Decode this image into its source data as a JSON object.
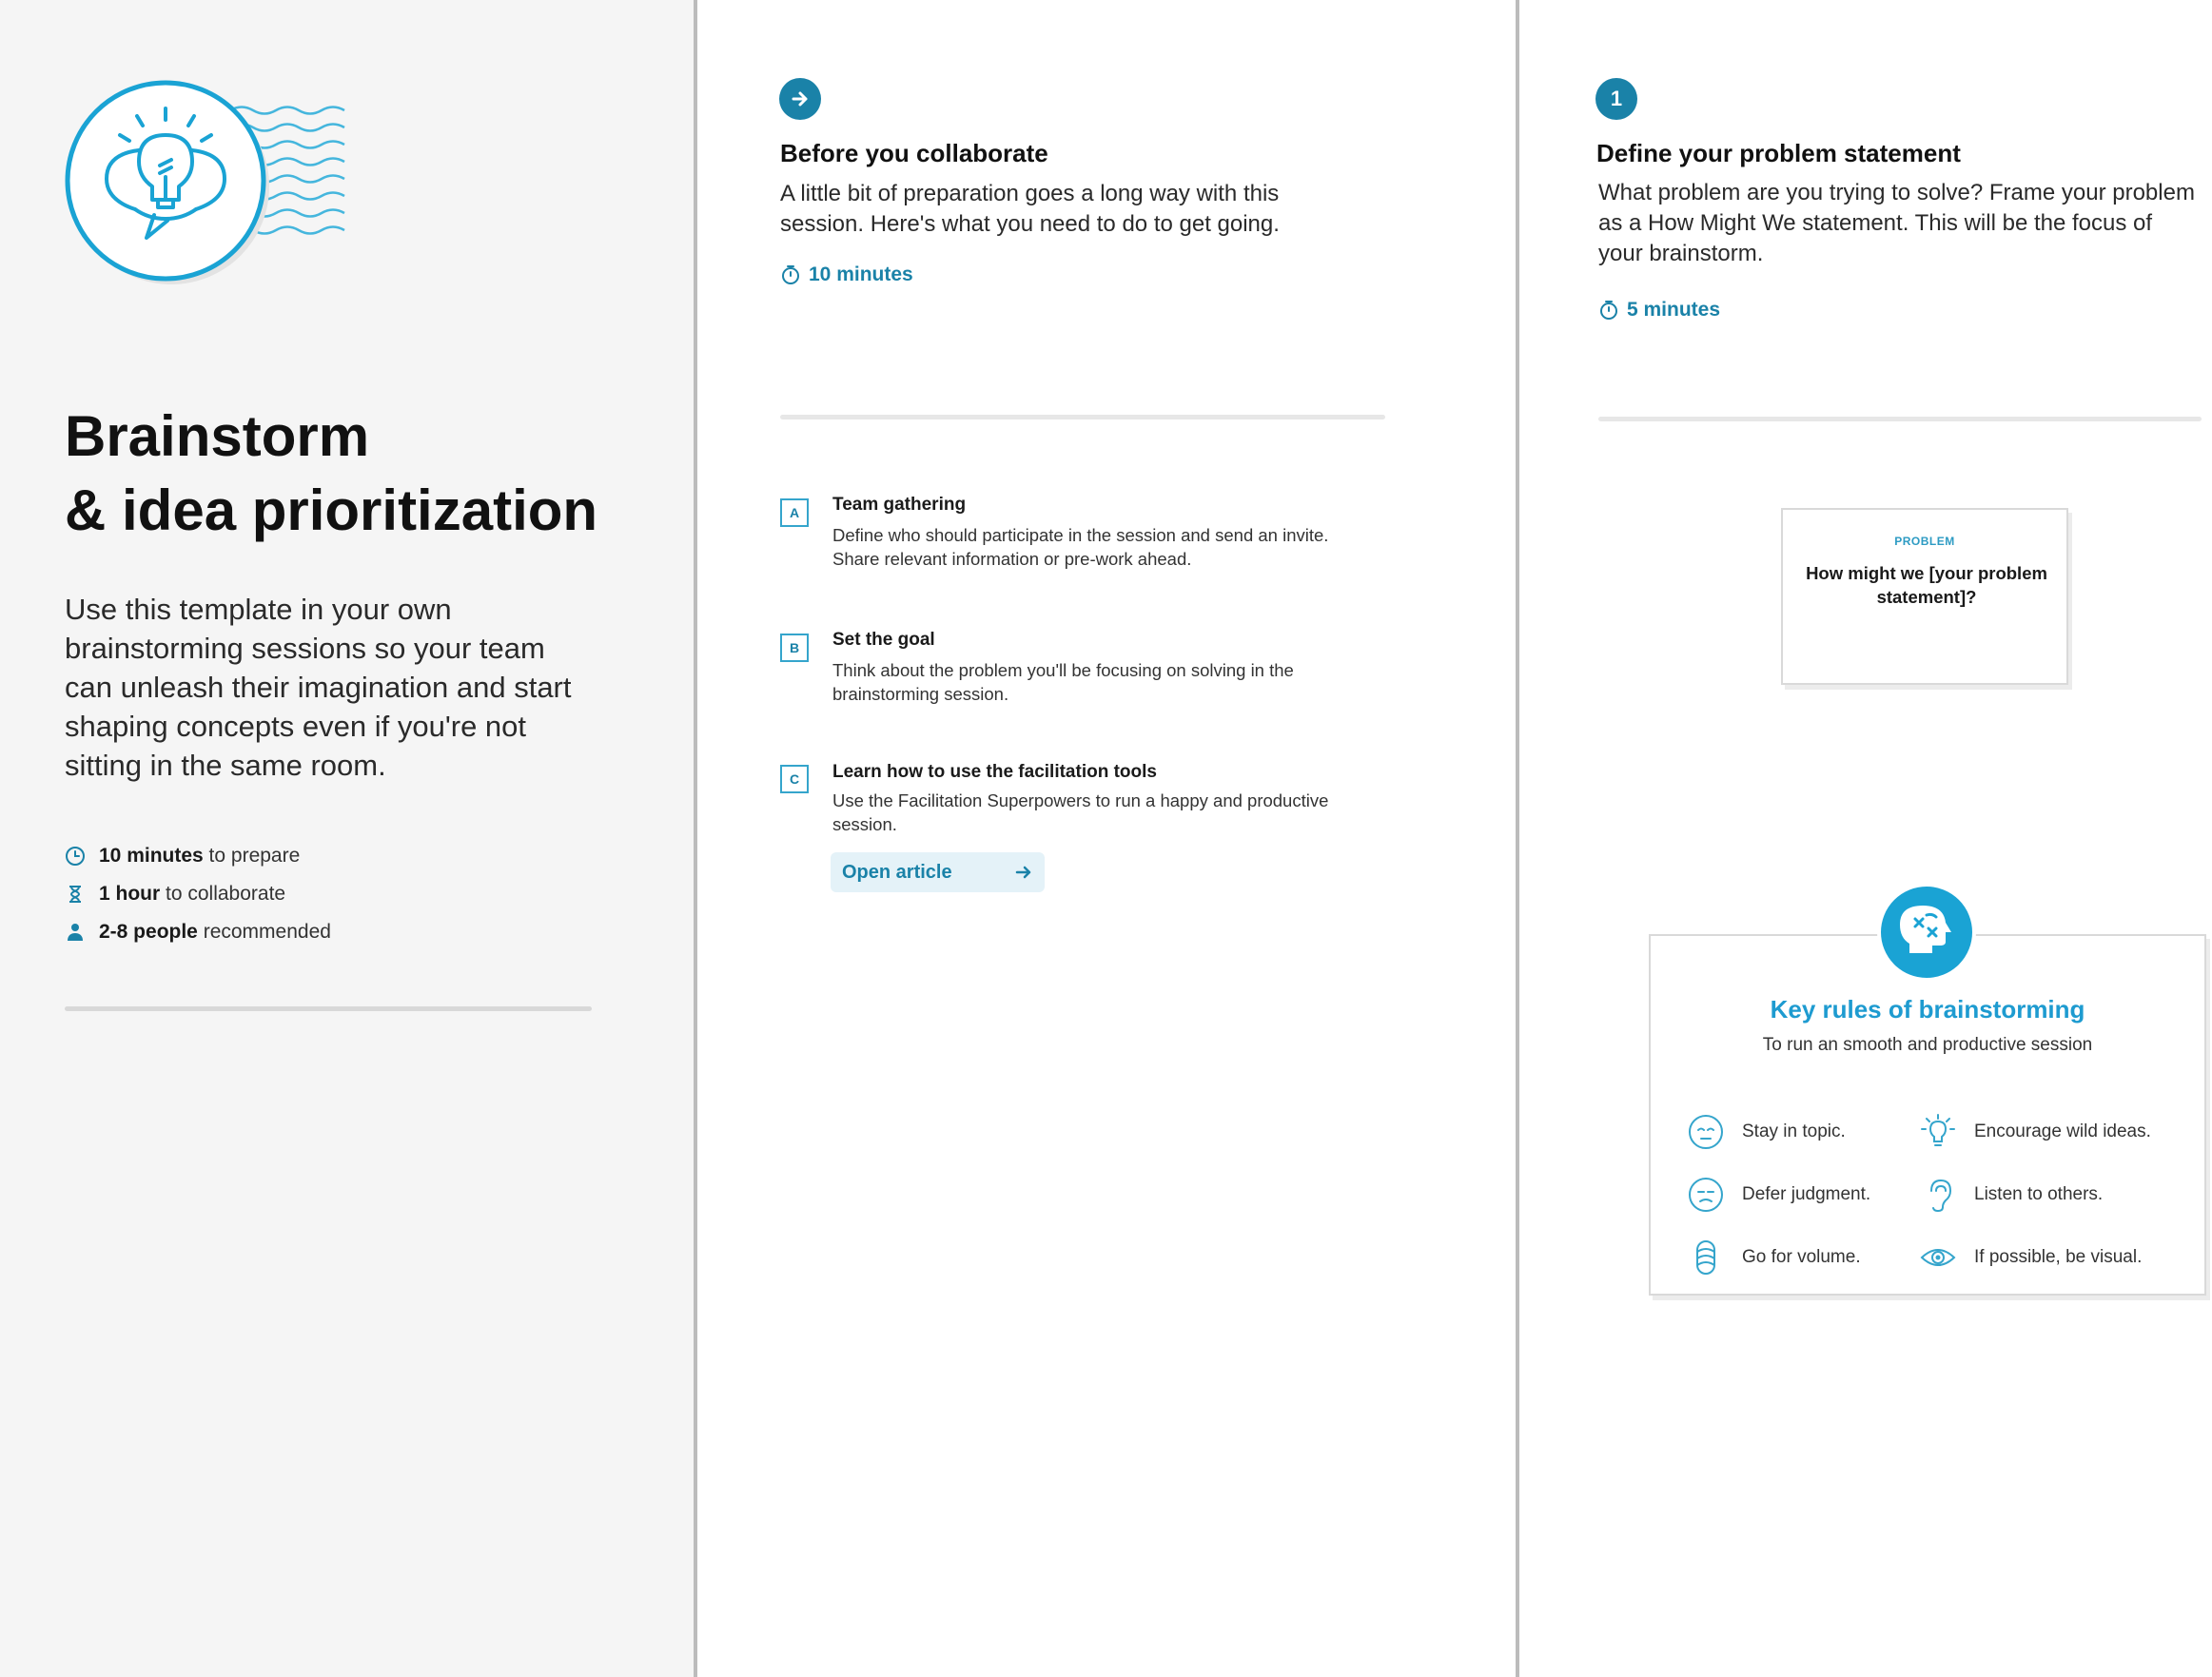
{
  "left": {
    "title_line1": "Brainstorm",
    "title_line2": "& idea prioritization",
    "description": "Use this template in your own brainstorming sessions so your team can unleash their imagination and start shaping concepts even if you're not sitting in the same room.",
    "meta": [
      {
        "icon": "clock-icon",
        "bold": "10 minutes",
        "text": " to prepare"
      },
      {
        "icon": "hourglass-icon",
        "bold": "1 hour",
        "text": " to collaborate"
      },
      {
        "icon": "person-icon",
        "bold": "2-8 people",
        "text": " recommended"
      }
    ]
  },
  "middle": {
    "title": "Before you collaborate",
    "description": "A little bit of preparation goes a long way with this session. Here's what you need to do to get going.",
    "timer": "10 minutes",
    "items": [
      {
        "letter": "A",
        "title": "Team gathering",
        "description": "Define who should participate in the session and send an invite. Share relevant information or pre-work ahead."
      },
      {
        "letter": "B",
        "title": "Set the goal",
        "description": "Think about the problem you'll be focusing on solving in the brainstorming session."
      },
      {
        "letter": "C",
        "title": "Learn how to use the facilitation tools",
        "description": "Use the Facilitation Superpowers to run a happy and productive session."
      }
    ],
    "open_article_label": "Open article"
  },
  "right": {
    "step_number": "1",
    "title": "Define your problem statement",
    "description": "What problem are you trying to solve? Frame your problem as a How Might We statement. This will be the focus of your brainstorm.",
    "timer": "5 minutes",
    "problem_card": {
      "label": "PROBLEM",
      "text": "How might we [your problem statement]?"
    },
    "rules_card": {
      "title": "Key rules of brainstorming",
      "subtitle": "To run an smooth and productive session",
      "rules": [
        {
          "icon": "face-icon",
          "label": "Stay in topic."
        },
        {
          "icon": "lightbulb-icon",
          "label": "Encourage wild ideas."
        },
        {
          "icon": "face-neutral-icon",
          "label": "Defer judgment."
        },
        {
          "icon": "ear-icon",
          "label": "Listen to others."
        },
        {
          "icon": "stack-icon",
          "label": "Go for volume."
        },
        {
          "icon": "eye-icon",
          "label": "If possible, be visual."
        }
      ]
    }
  },
  "colors": {
    "accent": "#1a82a8",
    "accent_light": "#1e9bd0",
    "left_bg": "#f5f5f5"
  }
}
